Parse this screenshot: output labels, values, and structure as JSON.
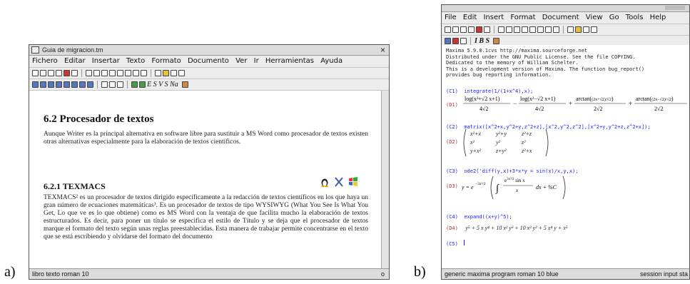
{
  "labels": {
    "a": "a)",
    "b": "b)"
  },
  "writer": {
    "title": "Guia de migracion.tm",
    "close_glyph": "×",
    "menu": [
      "Fichero",
      "Editar",
      "Insertar",
      "Texto",
      "Formato",
      "Documento",
      "Ver",
      "Ir",
      "Herramientas",
      "Ayuda"
    ],
    "format_text": "E S V S Na",
    "section_title": "6.2  Procesador de textos",
    "section_para": "Aunque Writer es la principal alternativa en software libre para sustituir a MS Word como procesador de textos existen otras alternativas especialmente para la elaboración de textos científicos.",
    "subsection_title": "6.2.1  TEXMACS",
    "body_para": "TEXMACS² es un procesador de textos dirigido específicamente a la redacción de textos científicos en los que haya un gran número de ecuaciones matemáticas³. Es un procesador de textos de tipo WYSIWYG (What You See Is What You Get, Lo que ve es lo que obtiene) como es MS Word con la ventaja de que facilita mucho la elaboración de textos estructurados. Es decir, para poner un título se especifica el estilo de Título y se deja que el procesador de textos marque el formato del texto según unas reglas preestablecidas. Esta manera de trabajar permite concentrarse en el texto que se está escribiendo y olvidarse del formato del documento",
    "status": "libro texto roman 10",
    "status_right": "o"
  },
  "maxima": {
    "menu": [
      "File",
      "Edit",
      "Insert",
      "Format",
      "Document",
      "View",
      "Go",
      "Tools",
      "Help"
    ],
    "format_text": "I B S",
    "banner": "Maxima 5.9.0.1cvs http://maxima.sourceforge.net\nDistributed under the GNU Public License. See the file COPYING.\nDedicated to the memory of William Schelter.\nThis is a development version of Maxima. The function bug_report()\nprovides bug reporting information.",
    "cells": [
      {
        "in_label": "(C1)",
        "input": "integrate(1/(1+x^4),x);",
        "out_label": "(D1)",
        "output": "log(x²+√2x+1)/(4√2) − log(x²−√2x+1)/(4√2) + arctan((2x+√2)/√2)/(2√2) + arctan((2x−√2)/√2)/(2√2)"
      },
      {
        "in_label": "(C2)",
        "input": "matrix([x^2+x,y^2+y,z^2+z],[x^2,y^2,z^2],[x^2+y,y^2+z,z^2+x]);",
        "out_label": "(D2)",
        "output": "matrix"
      },
      {
        "in_label": "(C3)",
        "input": "ode2('diff(y,x)+3*x*y = sin(x)/x,y,x);",
        "out_label": "(D3)",
        "output": "y = e^(−3x²/2) ( ∫ e^(3x²/2) sin x / x dx + %C )"
      },
      {
        "in_label": "(C4)",
        "input": "expand((x+y)^5);",
        "out_label": "(D4)",
        "output": "y⁵ + 5 x y⁴ + 10 x² y³ + 10 x³ y² + 5 x⁴ y + x⁵"
      },
      {
        "in_label": "(C5)",
        "input": "",
        "out_label": "",
        "output": ""
      }
    ],
    "matrix_rows": [
      [
        "x²+x",
        "y²+y",
        "z²+z"
      ],
      [
        "x²",
        "y²",
        "z²"
      ],
      [
        "y+x²",
        "z+y²",
        "z²+x"
      ]
    ],
    "status": "generic maxima program roman 10 blue",
    "status_right": "session input sta"
  }
}
